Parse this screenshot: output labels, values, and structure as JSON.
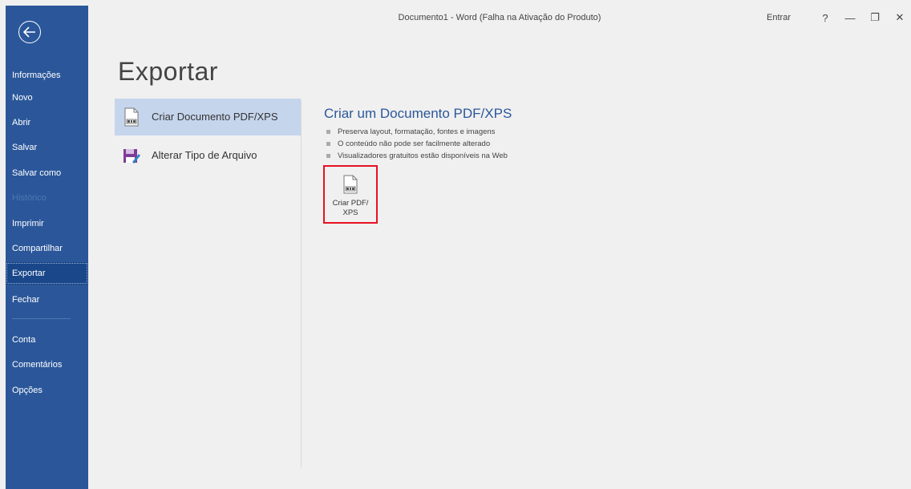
{
  "window": {
    "title": "Documento1  -  Word (Falha na Ativação do Produto)",
    "sign_in": "Entrar",
    "help": "?",
    "minimize": "—",
    "restore": "❐",
    "close": "✕"
  },
  "sidebar": {
    "items": [
      {
        "label": "Informações"
      },
      {
        "label": "Novo"
      },
      {
        "label": "Abrir"
      },
      {
        "label": "Salvar"
      },
      {
        "label": "Salvar como"
      },
      {
        "label": "Histórico"
      },
      {
        "label": "Imprimir"
      },
      {
        "label": "Compartilhar"
      },
      {
        "label": "Exportar"
      },
      {
        "label": "Fechar"
      },
      {
        "label": "Conta"
      },
      {
        "label": "Comentários"
      },
      {
        "label": "Opções"
      }
    ]
  },
  "main": {
    "page_title": "Exportar",
    "options": [
      {
        "label": "Criar Documento PDF/XPS",
        "icon": "pdf-document-icon"
      },
      {
        "label": "Alterar Tipo de Arquivo",
        "icon": "save-edit-icon"
      }
    ],
    "detail": {
      "title": "Criar um Documento PDF/XPS",
      "bullets": [
        "Preserva layout, formatação, fontes e imagens",
        "O conteúdo não pode ser facilmente alterado",
        "Visualizadores gratuitos estão disponíveis na Web"
      ],
      "button_line1": "Criar PDF/",
      "button_line2": "XPS"
    }
  },
  "colors": {
    "brand": "#2b579a",
    "active_nav": "#19478a",
    "selected_option": "#c5d5ec",
    "highlight_border": "#e81123"
  }
}
